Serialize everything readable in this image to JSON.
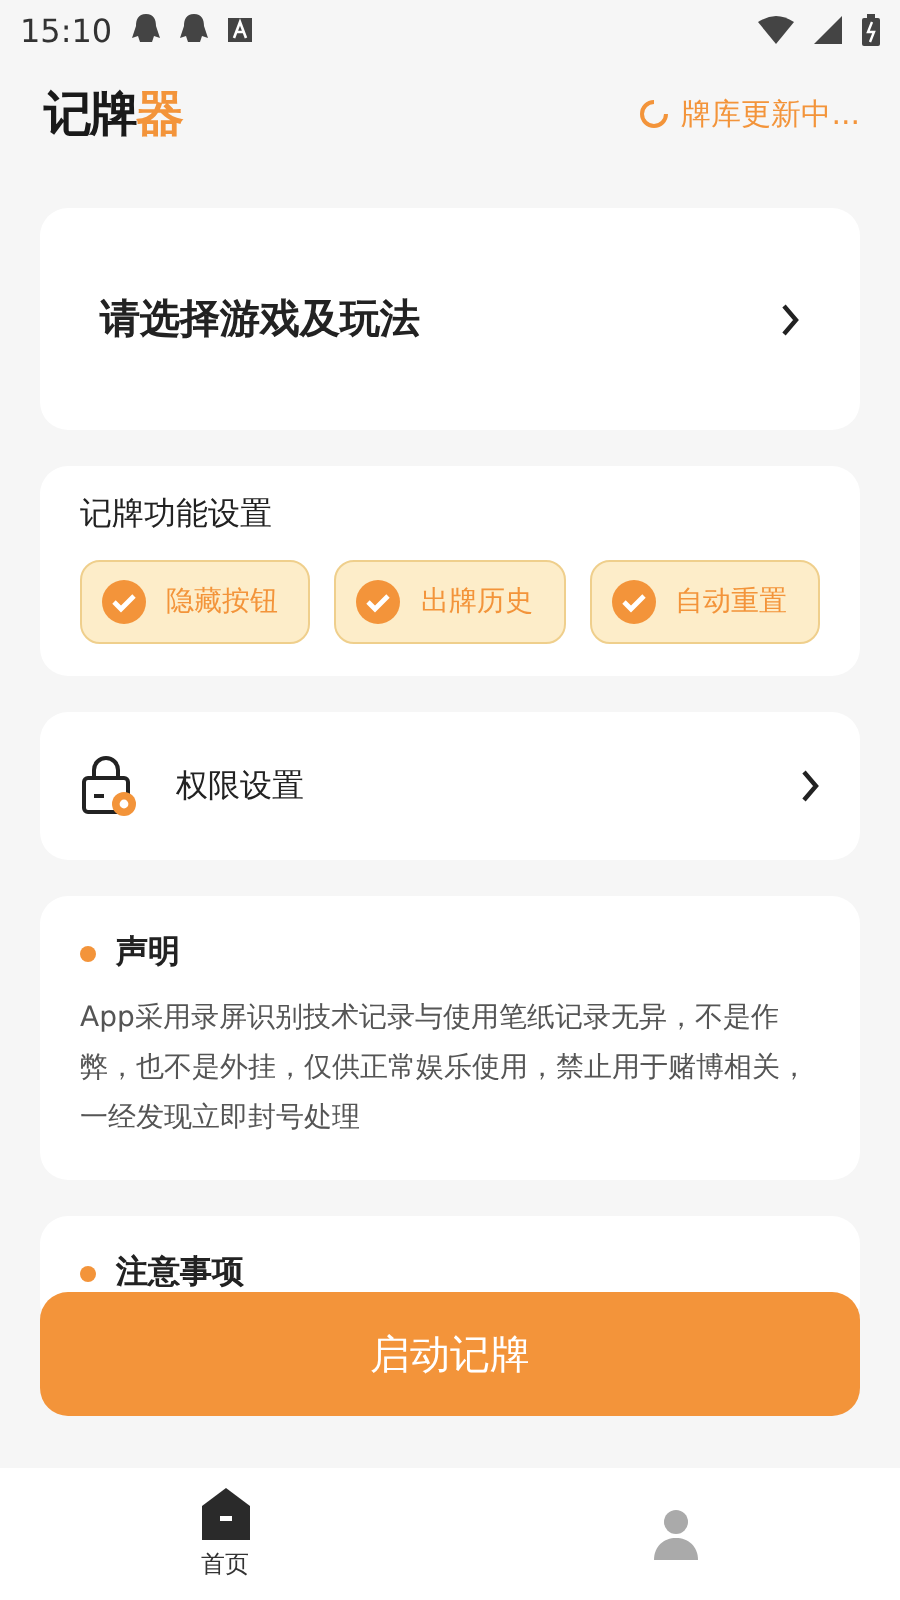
{
  "status_bar": {
    "time": "15:10"
  },
  "header": {
    "logo_parts": [
      {
        "text": "记牌",
        "accent": false
      },
      {
        "text": "器",
        "accent": true
      }
    ],
    "sync_status": "牌库更新中..."
  },
  "game_select": {
    "label": "请选择游戏及玩法"
  },
  "features": {
    "title": "记牌功能设置",
    "options": [
      {
        "label": "隐藏按钮",
        "checked": true
      },
      {
        "label": "出牌历史",
        "checked": true
      },
      {
        "label": "自动重置",
        "checked": true
      }
    ]
  },
  "permissions": {
    "label": "权限设置"
  },
  "notices": [
    {
      "title": "声明",
      "body": "App采用录屏识别技术记录与使用笔纸记录无异，不是作弊，也不是外挂，仅供正常娱乐使用，禁止用于赌博相关，一经发现立即封号处理"
    },
    {
      "title": "注意事项"
    }
  ],
  "start_button": "启动记牌",
  "bottom_nav": [
    {
      "kind": "home",
      "label": "首页",
      "selected": true
    },
    {
      "kind": "profile",
      "selected": false
    }
  ]
}
